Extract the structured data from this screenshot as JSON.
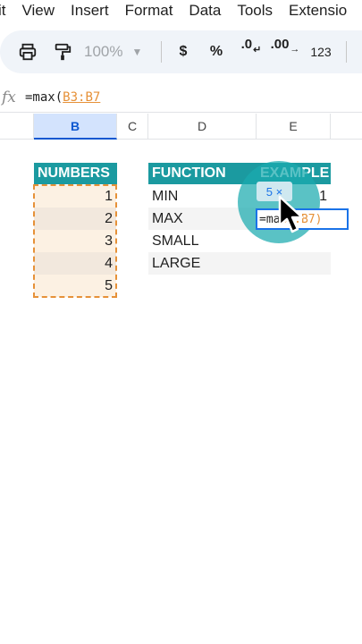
{
  "menu": [
    "it",
    "View",
    "Insert",
    "Format",
    "Data",
    "Tools",
    "Extensio"
  ],
  "toolbar": {
    "zoom": "100%",
    "currency": "$",
    "percent": "%",
    "decrease_decimals": ".0",
    "increase_decimals": ".00",
    "number_format": "123",
    "icons": [
      "print-icon",
      "paint-format-icon",
      "chevron-down-icon",
      "decrease-arrow-icon",
      "increase-arrow-icon"
    ]
  },
  "formula_bar": {
    "fx_label": "fx",
    "formula_prefix": "=max(",
    "formula_ref": "B3:B7"
  },
  "columns": [
    "B",
    "C",
    "D",
    "E"
  ],
  "numbers_table": {
    "header": "NUMBERS",
    "values": [
      "1",
      "2",
      "3",
      "4",
      "5"
    ]
  },
  "function_table": {
    "header_function": "FUNCTION",
    "header_example": "EXAMPLE",
    "rows": [
      {
        "function": "MIN",
        "example": "1"
      },
      {
        "function": "MAX",
        "example": ""
      },
      {
        "function": "SMALL",
        "example": ""
      },
      {
        "function": "LARGE",
        "example": ""
      }
    ]
  },
  "overlay": {
    "count_chip": "5 ×",
    "edit_prefix": "=ma",
    "edit_ref": "B3:B7",
    "edit_suffix": ")"
  },
  "colors": {
    "header_teal": "#1b9aa0",
    "range_orange": "#e69138",
    "selection_blue": "#1a73e8",
    "band_even": "#f4f4f4",
    "number_fill": "#fcefe0"
  }
}
